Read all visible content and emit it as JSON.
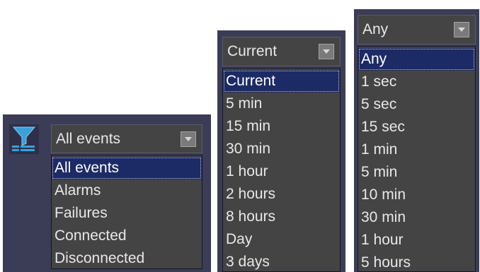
{
  "events_filter": {
    "icon": "filter-icon",
    "selected": "All events",
    "options": [
      "All events",
      "Alarms",
      "Failures",
      "Connected",
      "Disconnected"
    ]
  },
  "time_range": {
    "selected": "Current",
    "options": [
      "Current",
      "5 min",
      "15 min",
      "30 min",
      "1 hour",
      "2 hours",
      "8 hours",
      "Day",
      "3 days"
    ]
  },
  "interval": {
    "selected": "Any",
    "options": [
      "Any",
      "1 sec",
      "5 sec",
      "15 sec",
      "1 min",
      "5 min",
      "10 min",
      "30 min",
      "1 hour",
      "5 hours"
    ]
  },
  "colors": {
    "panel": "#3b3c55",
    "list_bg": "#444444",
    "highlight": "#1c2b66",
    "icon_blue": "#3aa0d8"
  }
}
